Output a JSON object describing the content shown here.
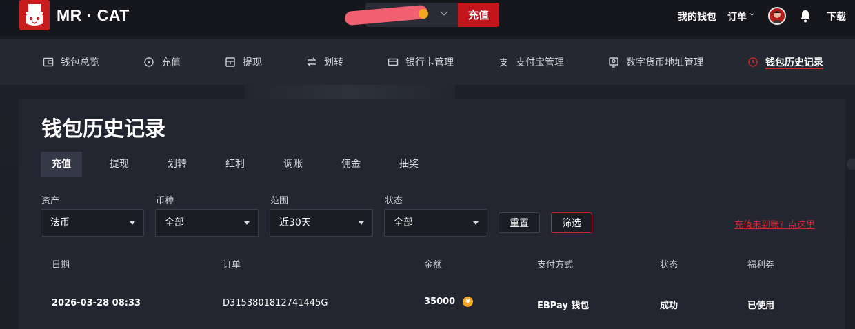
{
  "header": {
    "logo_text": "MR · CAT",
    "deposit_button": "充值",
    "links": {
      "wallet": "我的钱包",
      "orders": "订单",
      "download": "下载"
    }
  },
  "nav": {
    "items": [
      {
        "label": "钱包总览",
        "icon": "wallet-icon"
      },
      {
        "label": "充值",
        "icon": "deposit-icon"
      },
      {
        "label": "提现",
        "icon": "withdraw-icon"
      },
      {
        "label": "划转",
        "icon": "transfer-icon"
      },
      {
        "label": "银行卡管理",
        "icon": "bank-card-icon"
      },
      {
        "label": "支付宝管理",
        "icon": "alipay-icon"
      },
      {
        "label": "数字货币地址管理",
        "icon": "crypto-address-icon"
      },
      {
        "label": "钱包历史记录",
        "icon": "history-clock-icon",
        "active": true
      }
    ],
    "accent_color": "#d4262e"
  },
  "main": {
    "title": "钱包历史记录",
    "tabs": [
      "充值",
      "提现",
      "划转",
      "红利",
      "调账",
      "佣金",
      "抽奖"
    ],
    "active_tab": "充值",
    "filters": [
      {
        "label": "资产",
        "value": "法币"
      },
      {
        "label": "币种",
        "value": "全部"
      },
      {
        "label": "范围",
        "value": "近30天"
      },
      {
        "label": "状态",
        "value": "全部"
      }
    ],
    "reset_button": "重置",
    "filter_button": "筛选",
    "help_link": "充值未到账？点这里",
    "table": {
      "columns": [
        "日期",
        "订单",
        "金额",
        "支付方式",
        "状态",
        "福利券"
      ],
      "rows": [
        {
          "date": "2026-03-28 08:33",
          "order": "D3153801812741445G",
          "amount": "35000",
          "currency_symbol": "¥",
          "payment": "EBPay 钱包",
          "status": "成功",
          "coupon": "已使用"
        }
      ]
    }
  }
}
